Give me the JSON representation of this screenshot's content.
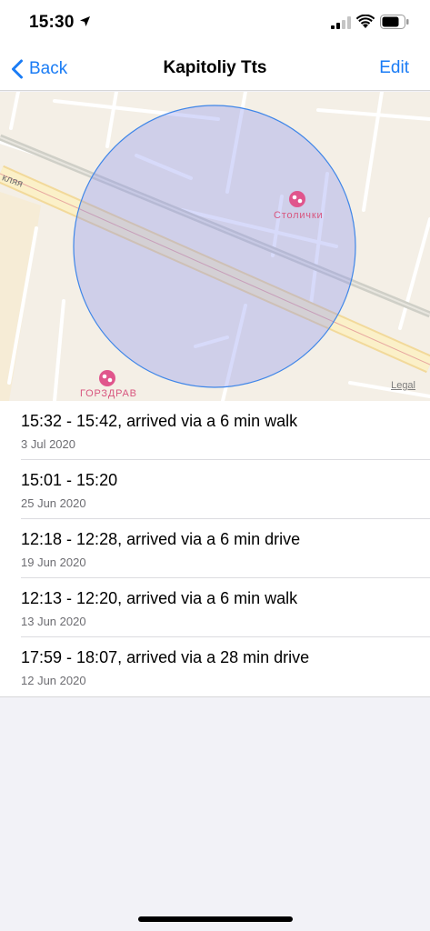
{
  "status_bar": {
    "time": "15:30",
    "icons": [
      "location-arrow-icon",
      "cellular-signal-icon",
      "wifi-icon",
      "battery-icon"
    ]
  },
  "nav": {
    "back_label": "Back",
    "title": "Kapitoliy Tts",
    "edit_label": "Edit"
  },
  "map": {
    "street_label": "кляя",
    "poi_1": "Столички",
    "poi_2": "ГОРЗДРАВ",
    "legal": "Legal",
    "accent_color": "#1a7cf5",
    "poi_color": "#d8567f"
  },
  "visits": [
    {
      "title": "15:32 - 15:42, arrived via a 6 min walk",
      "date": "3 Jul 2020"
    },
    {
      "title": "15:01 - 15:20",
      "date": "25 Jun 2020"
    },
    {
      "title": "12:18 - 12:28, arrived via a 6 min drive",
      "date": "19 Jun 2020"
    },
    {
      "title": "12:13 - 12:20, arrived via a 6 min walk",
      "date": "13 Jun 2020"
    },
    {
      "title": "17:59 - 18:07, arrived via a 28 min drive",
      "date": "12 Jun 2020"
    }
  ]
}
